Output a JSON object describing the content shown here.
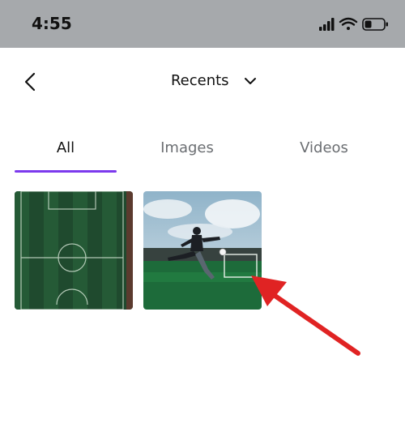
{
  "status": {
    "time": "4:55"
  },
  "header": {
    "title": "Recents"
  },
  "tabs": [
    {
      "label": "All",
      "active": true
    },
    {
      "label": "Images",
      "active": false
    },
    {
      "label": "Videos",
      "active": false
    }
  ],
  "colors": {
    "accent": "#7c3aed",
    "annotation_arrow": "#e02323",
    "status_bar": "#a6a9ac"
  },
  "gallery": [
    {
      "kind": "image",
      "icon": "soccer-field-aerial-photo"
    },
    {
      "kind": "image",
      "icon": "soccer-player-kicking-photo"
    }
  ]
}
